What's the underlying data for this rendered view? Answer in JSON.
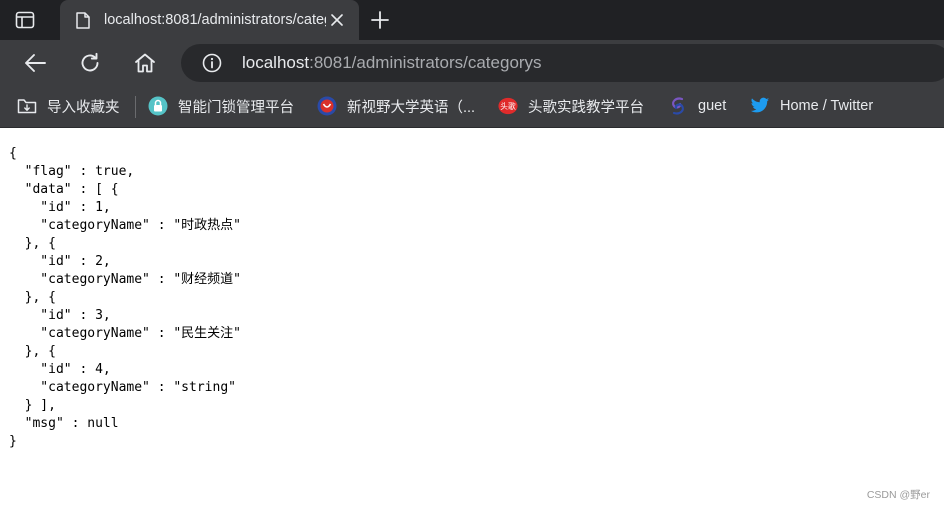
{
  "tab": {
    "title": "localhost:8081/administrators/categorys",
    "favicon": "page-icon"
  },
  "toolbar": {
    "back_icon": "back-arrow-icon",
    "reload_icon": "reload-icon",
    "home_icon": "home-icon"
  },
  "address_bar": {
    "host": "localhost",
    "rest": ":8081/administrators/categorys",
    "site_info_icon": "info-icon"
  },
  "bookmarks": {
    "folder": {
      "label": "导入收藏夹",
      "icon": "import-folder-icon"
    },
    "items": [
      {
        "label": "智能门锁管理平台",
        "icon": "lock-circle-icon",
        "color": "#55c3c7"
      },
      {
        "label": "新视野大学英语（...",
        "icon": "red-blue-logo-icon",
        "color": "#d9302a"
      },
      {
        "label": "头歌实践教学平台",
        "icon": "toutiao-logo-icon",
        "color": "#e02b2b"
      },
      {
        "label": "guet",
        "icon": "swirl-logo-icon",
        "color": "#7a56c2"
      },
      {
        "label": "Home / Twitter",
        "icon": "twitter-bird-icon",
        "color": "#1d9bf0"
      }
    ]
  },
  "response_json": "{\n  \"flag\" : true,\n  \"data\" : [ {\n    \"id\" : 1,\n    \"categoryName\" : \"时政热点\"\n  }, {\n    \"id\" : 2,\n    \"categoryName\" : \"财经频道\"\n  }, {\n    \"id\" : 3,\n    \"categoryName\" : \"民生关注\"\n  }, {\n    \"id\" : 4,\n    \"categoryName\" : \"string\"\n  } ],\n  \"msg\" : null\n}",
  "watermark": "CSDN @野er",
  "colors": {
    "tabstrip": "#202124",
    "toolbar": "#3c3d40",
    "omnibox": "#28292c",
    "text_light": "#e8eaed"
  }
}
